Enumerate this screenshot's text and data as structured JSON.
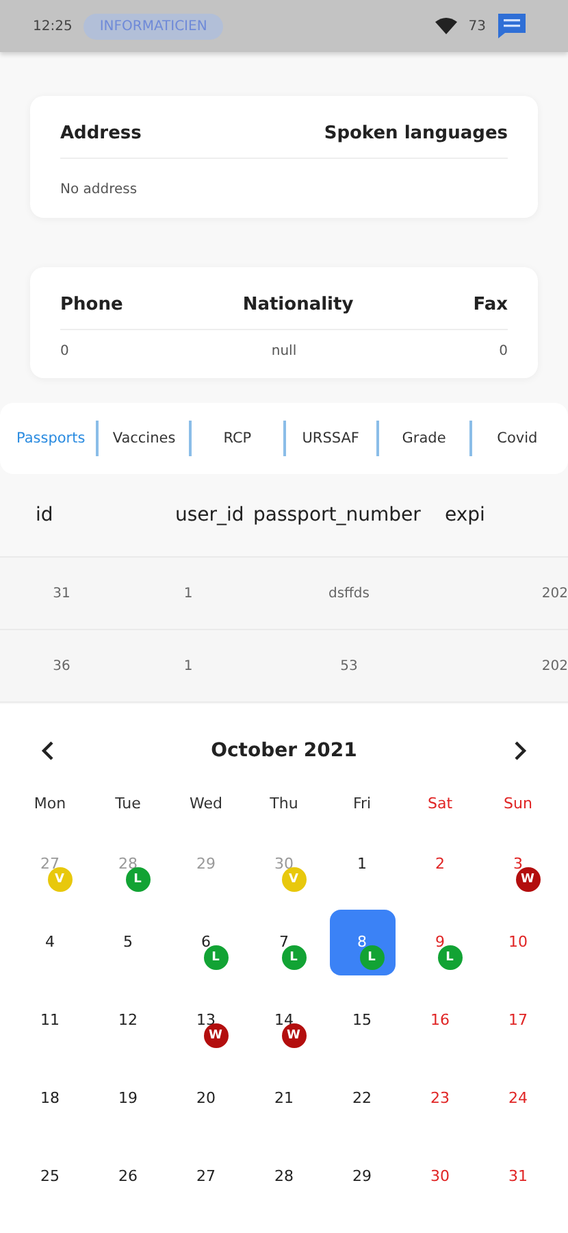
{
  "status_bar": {
    "time": "12:25",
    "pill": "INFORMATICIEN",
    "battery": "73"
  },
  "address_card": {
    "headers": [
      "Address",
      "Spoken languages"
    ],
    "value": "No address"
  },
  "contact_card": {
    "columns": [
      {
        "label": "Phone",
        "value": "0"
      },
      {
        "label": "Nationality",
        "value": "null"
      },
      {
        "label": "Fax",
        "value": "0"
      }
    ]
  },
  "tabs": [
    {
      "label": "Passports",
      "selected": true
    },
    {
      "label": "Vaccines",
      "selected": false
    },
    {
      "label": "RCP",
      "selected": false
    },
    {
      "label": "URSSAF",
      "selected": false
    },
    {
      "label": "Grade",
      "selected": false
    },
    {
      "label": "Covid",
      "selected": false
    }
  ],
  "table": {
    "columns": [
      "id",
      "user_id",
      "passport_number",
      "expi"
    ],
    "rows": [
      [
        "31",
        "1",
        "dsffds",
        "202"
      ],
      [
        "36",
        "1",
        "53",
        "202"
      ]
    ]
  },
  "calendar": {
    "title": "October 2021",
    "weekdays": [
      "Mon",
      "Tue",
      "Wed",
      "Thu",
      "Fri",
      "Sat",
      "Sun"
    ],
    "weeks": [
      [
        {
          "day": "27",
          "muted": true,
          "selected": false,
          "badge": {
            "letter": "V",
            "color": "#e8c80c"
          }
        },
        {
          "day": "28",
          "muted": true,
          "selected": false,
          "badge": {
            "letter": "L",
            "color": "#12a334"
          }
        },
        {
          "day": "29",
          "muted": true,
          "selected": false
        },
        {
          "day": "30",
          "muted": true,
          "selected": false,
          "badge": {
            "letter": "V",
            "color": "#e8c80c"
          }
        },
        {
          "day": "1",
          "muted": false,
          "selected": false
        },
        {
          "day": "2",
          "muted": false,
          "selected": false
        },
        {
          "day": "3",
          "muted": false,
          "selected": false,
          "badge": {
            "letter": "W",
            "color": "#b30e0e"
          }
        }
      ],
      [
        {
          "day": "4",
          "muted": false,
          "selected": false
        },
        {
          "day": "5",
          "muted": false,
          "selected": false
        },
        {
          "day": "6",
          "muted": false,
          "selected": false,
          "badge": {
            "letter": "L",
            "color": "#12a334"
          }
        },
        {
          "day": "7",
          "muted": false,
          "selected": false,
          "badge": {
            "letter": "L",
            "color": "#12a334"
          }
        },
        {
          "day": "8",
          "muted": false,
          "selected": true,
          "badge": {
            "letter": "L",
            "color": "#12a334"
          }
        },
        {
          "day": "9",
          "muted": false,
          "selected": false,
          "badge": {
            "letter": "L",
            "color": "#12a334"
          }
        },
        {
          "day": "10",
          "muted": false,
          "selected": false
        }
      ],
      [
        {
          "day": "11",
          "muted": false,
          "selected": false
        },
        {
          "day": "12",
          "muted": false,
          "selected": false
        },
        {
          "day": "13",
          "muted": false,
          "selected": false,
          "badge": {
            "letter": "W",
            "color": "#b30e0e"
          }
        },
        {
          "day": "14",
          "muted": false,
          "selected": false,
          "badge": {
            "letter": "W",
            "color": "#b30e0e"
          }
        },
        {
          "day": "15",
          "muted": false,
          "selected": false
        },
        {
          "day": "16",
          "muted": false,
          "selected": false
        },
        {
          "day": "17",
          "muted": false,
          "selected": false
        }
      ],
      [
        {
          "day": "18",
          "muted": false,
          "selected": false
        },
        {
          "day": "19",
          "muted": false,
          "selected": false
        },
        {
          "day": "20",
          "muted": false,
          "selected": false
        },
        {
          "day": "21",
          "muted": false,
          "selected": false
        },
        {
          "day": "22",
          "muted": false,
          "selected": false
        },
        {
          "day": "23",
          "muted": false,
          "selected": false
        },
        {
          "day": "24",
          "muted": false,
          "selected": false
        }
      ],
      [
        {
          "day": "25",
          "muted": false,
          "selected": false
        },
        {
          "day": "26",
          "muted": false,
          "selected": false
        },
        {
          "day": "27",
          "muted": false,
          "selected": false
        },
        {
          "day": "28",
          "muted": false,
          "selected": false
        },
        {
          "day": "29",
          "muted": false,
          "selected": false
        },
        {
          "day": "30",
          "muted": false,
          "selected": false
        },
        {
          "day": "31",
          "muted": false,
          "selected": false
        }
      ]
    ]
  }
}
